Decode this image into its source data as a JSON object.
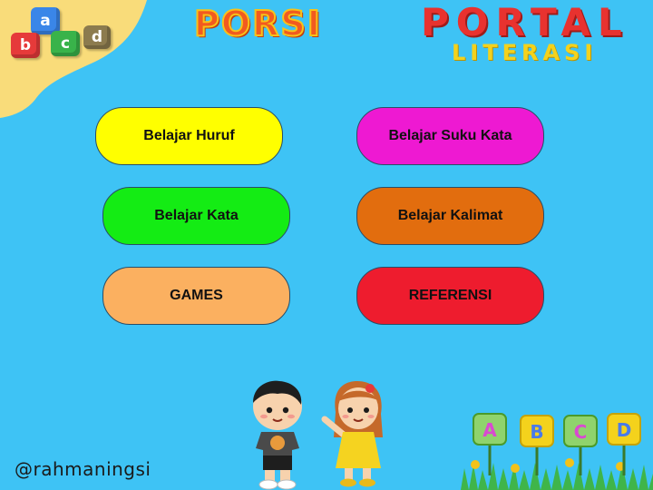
{
  "header": {
    "logo_letters": [
      "a",
      "b",
      "c",
      "d"
    ],
    "title_porsi": "PORSI",
    "title_portal": "PORTAL",
    "title_literasi": "LITERASI"
  },
  "menu": {
    "belajar_huruf": "Belajar Huruf",
    "belajar_suku_kata": "Belajar Suku Kata",
    "belajar_kata": "Belajar Kata",
    "belajar_kalimat": "Belajar Kalimat",
    "games": "GAMES",
    "referensi": "REFERENSI"
  },
  "footer": {
    "handle": "@rahmaningsi",
    "garden_letters": [
      "A",
      "B",
      "C",
      "D"
    ]
  },
  "colors": {
    "background": "#3ec3f5",
    "corner": "#f9dc7a",
    "belajar_huruf": "#ffff00",
    "belajar_suku_kata": "#ee19d2",
    "belajar_kata": "#14ec14",
    "belajar_kalimat": "#e26d0e",
    "games": "#fbb060",
    "referensi": "#ee1c2e"
  }
}
